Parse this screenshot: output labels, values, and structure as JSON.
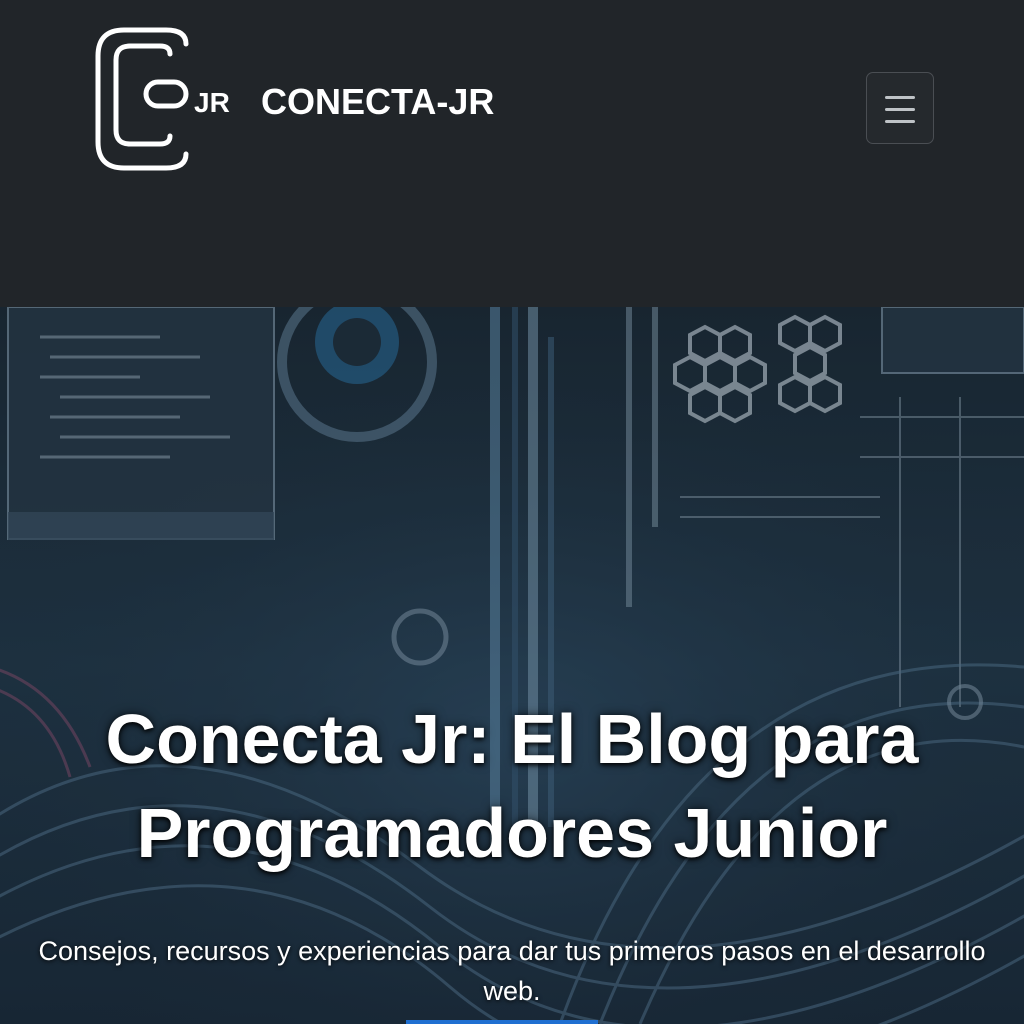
{
  "navbar": {
    "logo_text": "JR",
    "brand_name": "CONECTA-JR",
    "menu_icon": "hamburger-menu-icon"
  },
  "hero": {
    "title_line1": "Conecta Jr: El Blog para",
    "title_line2": "Programadores Junior",
    "subtitle": "Consejos, recursos y experiencias para dar tus primeros pasos en el desarrollo web."
  },
  "colors": {
    "navbar_bg": "#212529",
    "hero_bg": "#1a2733",
    "accent": "#1f6fd1",
    "text": "#ffffff"
  }
}
